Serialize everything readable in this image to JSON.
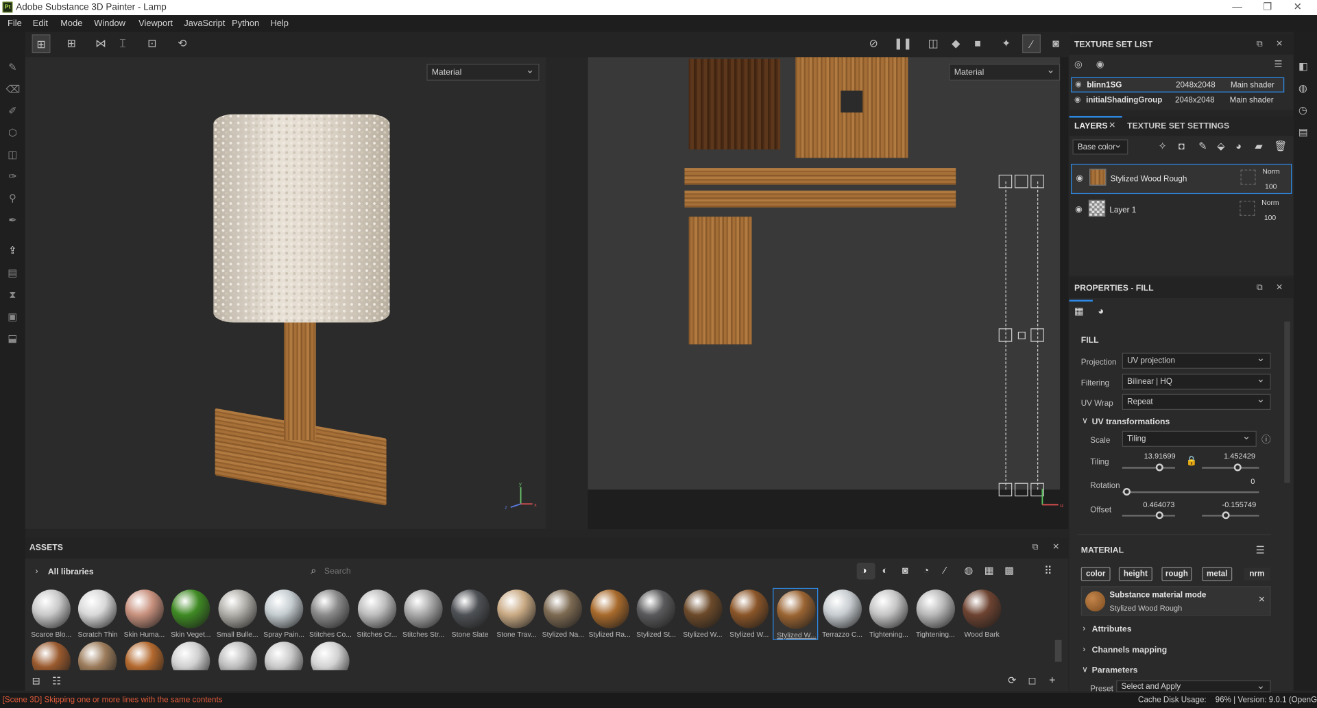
{
  "titlebar": {
    "title": "Adobe Substance 3D Painter - Lamp",
    "logo": "Pt",
    "minimize": "—",
    "maximize": "❐",
    "close": "✕"
  },
  "menu": [
    "File",
    "Edit",
    "Mode",
    "Window",
    "Viewport",
    "JavaScript",
    "Python",
    "Help"
  ],
  "viewport3d": {
    "mode": "Material",
    "axes": {
      "x": "x",
      "y": "y",
      "z": "z"
    }
  },
  "viewport2d": {
    "mode": "Material",
    "u_axis": "u"
  },
  "texture_set_list": {
    "title": "TEXTURE SET LIST",
    "rows": [
      {
        "name": "blinn1SG",
        "res": "2048x2048",
        "shader": "Main shader"
      },
      {
        "name": "initialShadingGroup",
        "res": "2048x2048",
        "shader": "Main shader"
      }
    ]
  },
  "layers": {
    "tab_layers": "LAYERS",
    "tab_settings": "TEXTURE SET SETTINGS",
    "channel": "Base color",
    "items": [
      {
        "name": "Stylized Wood Rough",
        "blend": "Norm",
        "opacity": "100"
      },
      {
        "name": "Layer 1",
        "blend": "Norm",
        "opacity": "100"
      }
    ]
  },
  "properties": {
    "title": "PROPERTIES - FILL",
    "fill_label": "FILL",
    "projection_label": "Projection",
    "projection": "UV projection",
    "filtering_label": "Filtering",
    "filtering": "Bilinear | HQ",
    "uvwrap_label": "UV Wrap",
    "uvwrap": "Repeat",
    "uvtrans_label": "UV transformations",
    "scale_label": "Scale",
    "scale": "Tiling",
    "tiling_label": "Tiling",
    "tiling_x": "13.91699",
    "tiling_y": "1.452429",
    "rotation_label": "Rotation",
    "rotation": "0",
    "offset_label": "Offset",
    "offset_x": "0.464073",
    "offset_y": "-0.155749",
    "material_label": "MATERIAL",
    "chips": [
      "color",
      "height",
      "rough",
      "metal",
      "nrm"
    ],
    "sub_mode": "Substance material mode",
    "sub_name": "Stylized Wood Rough",
    "attributes": "Attributes",
    "channels_mapping": "Channels mapping",
    "parameters": "Parameters",
    "preset_label": "Preset",
    "preset": "Select and Apply"
  },
  "assets": {
    "title": "ASSETS",
    "all_libraries": "All libraries",
    "search_placeholder": "Search",
    "items": [
      {
        "label": "Scarce Blo...",
        "color": "#c9c9c9"
      },
      {
        "label": "Scratch Thin",
        "color": "#d8d8d8"
      },
      {
        "label": "Skin Huma...",
        "color": "#c8917e"
      },
      {
        "label": "Skin Veget...",
        "color": "#3f8a24"
      },
      {
        "label": "Small Bulle...",
        "color": "#b0aea8"
      },
      {
        "label": "Spray Pain...",
        "color": "#c4ccd0"
      },
      {
        "label": "Stitches Co...",
        "color": "#8a8a8a"
      },
      {
        "label": "Stitches Cr...",
        "color": "#bdbdbd"
      },
      {
        "label": "Stitches Str...",
        "color": "#a8a8a8"
      },
      {
        "label": "Stone Slate",
        "color": "#4e5155"
      },
      {
        "label": "Stone Trav...",
        "color": "#c9aa84"
      },
      {
        "label": "Stylized Na...",
        "color": "#7d6a52"
      },
      {
        "label": "Stylized Ra...",
        "color": "#a86a2c"
      },
      {
        "label": "Stylized St...",
        "color": "#5a5a5c"
      },
      {
        "label": "Stylized W...",
        "color": "#6c4a2a"
      },
      {
        "label": "Stylized W...",
        "color": "#8a5528"
      },
      {
        "label": "Stylized W...",
        "color": "#9a6432"
      },
      {
        "label": "Terrazzo C...",
        "color": "#c7ccd0"
      },
      {
        "label": "Tightening...",
        "color": "#c5c5c5"
      },
      {
        "label": "Tightening...",
        "color": "#b8b8b8"
      },
      {
        "label": "Wood Bark",
        "color": "#6d4331"
      }
    ],
    "selected_index": 16,
    "row2_colors": [
      "#9a5a2e",
      "#9b7b5a",
      "#b3692e",
      "#cfcfcf",
      "#bdbdbd",
      "#c8c8c8",
      "#d2d2d2"
    ]
  },
  "statusbar": {
    "message": "[Scene 3D] Skipping one or more lines with the same contents",
    "right": "Cache Disk Usage:    96% | Version: 9.0.1 (OpenGL)",
    "error_color": "#e05a3a"
  },
  "colors": {
    "accent": "#2d8ceb",
    "bg": "#252525"
  }
}
